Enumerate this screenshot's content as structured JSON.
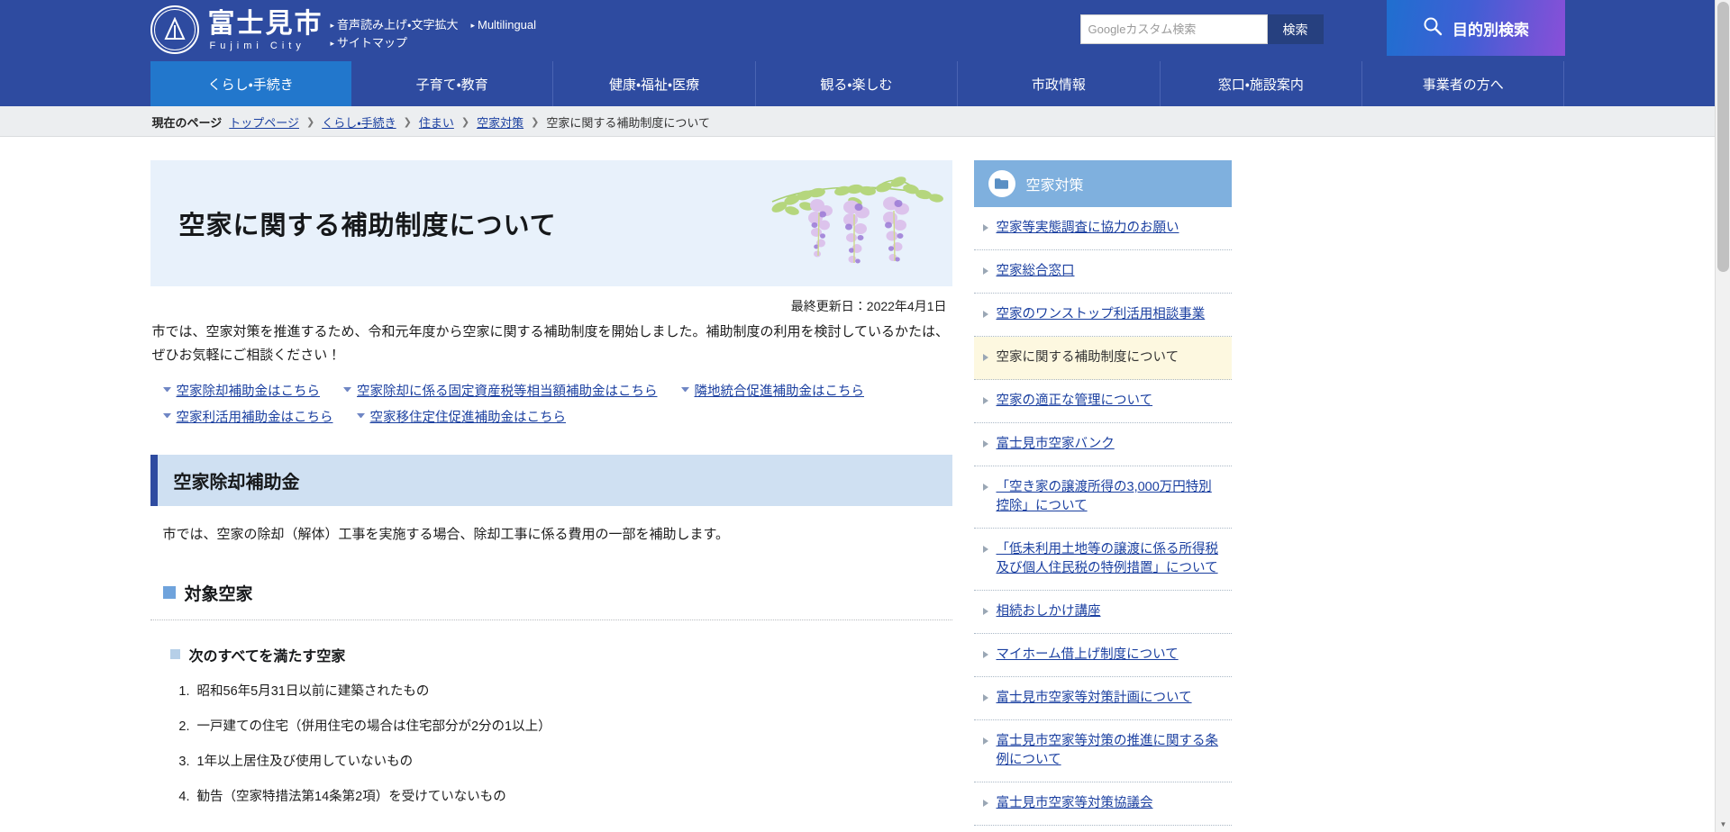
{
  "header": {
    "logo_jp": "富士見市",
    "logo_en": "Fujimi City",
    "util_links": [
      "音声読み上げ・文字拡大",
      "Multilingual",
      "サイトマップ"
    ],
    "search_placeholder": "Googleカスタム検索",
    "search_value": "",
    "search_button": "検索",
    "purpose_button": "目的別検索"
  },
  "gnav": [
    {
      "label": "くらし・手続き",
      "active": true
    },
    {
      "label": "子育て・教育",
      "active": false
    },
    {
      "label": "健康・福祉・医療",
      "active": false
    },
    {
      "label": "観る・楽しむ",
      "active": false
    },
    {
      "label": "市政情報",
      "active": false
    },
    {
      "label": "窓口・施設案内",
      "active": false
    },
    {
      "label": "事業者の方へ",
      "active": false
    }
  ],
  "breadcrumb": {
    "label": "現在のページ",
    "items": [
      "トップページ",
      "くらし・手続き",
      "住まい",
      "空家対策"
    ],
    "current": "空家に関する補助制度について"
  },
  "main": {
    "page_title": "空家に関する補助制度について",
    "updated": "最終更新日：2022年4月1日",
    "lead": "市では、空家対策を推進するため、令和元年度から空家に関する補助制度を開始しました。補助制度の利用を検討しているかたは、ぜひお気軽にご相談ください！",
    "anchor_links_row1": [
      "空家除却補助金はこちら",
      "空家除却に係る固定資産税等相当額補助金はこちら",
      "隣地統合促進補助金はこちら"
    ],
    "anchor_links_row2": [
      "空家利活用補助金はこちら",
      "空家移住定住促進補助金はこちら"
    ],
    "section_heading": "空家除却補助金",
    "section_body": "市では、空家の除却（解体）工事を実施する場合、除却工事に係る費用の一部を補助します。",
    "subheading": "対象空家",
    "subsubheading": "次のすべてを満たす空家",
    "conditions": [
      "昭和56年5月31日以前に建築されたもの",
      "一戸建ての住宅（併用住宅の場合は住宅部分が2分の1以上）",
      "1年以上居住及び使用していないもの",
      "勧告（空家特措法第14条第2項）を受けていないもの"
    ]
  },
  "sidebar": {
    "title": "空家対策",
    "items": [
      {
        "label": "空家等実態調査に協力のお願い",
        "active": false
      },
      {
        "label": "空家総合窓口",
        "active": false
      },
      {
        "label": "空家のワンストップ利活用相談事業",
        "active": false
      },
      {
        "label": "空家に関する補助制度について",
        "active": true
      },
      {
        "label": "空家の適正な管理について",
        "active": false
      },
      {
        "label": "富士見市空家バンク",
        "active": false
      },
      {
        "label": "「空き家の譲渡所得の3,000万円特別控除」について",
        "active": false
      },
      {
        "label": "「低未利用土地等の譲渡に係る所得税及び個人住民税の特例措置」について",
        "active": false
      },
      {
        "label": "相続おしかけ講座",
        "active": false
      },
      {
        "label": "マイホーム借上げ制度について",
        "active": false
      },
      {
        "label": "富士見市空家等対策計画について",
        "active": false
      },
      {
        "label": "富士見市空家等対策の推進に関する条例について",
        "active": false
      },
      {
        "label": "富士見市空家等対策協議会",
        "active": false
      }
    ]
  },
  "colors": {
    "header_blue": "#2e4ba0",
    "nav_active": "#2277cc",
    "title_banner": "#e8f1fb",
    "section_heading_bg": "#cfe0f2",
    "sidebar_head": "#7fb0de",
    "active_item": "#fdf8e0",
    "link": "#1a3fa0"
  }
}
